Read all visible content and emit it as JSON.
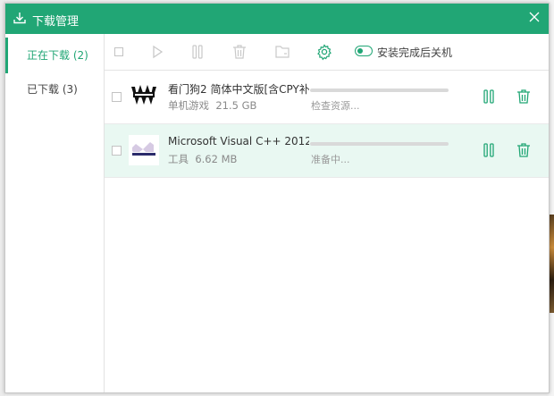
{
  "window": {
    "title": "下载管理"
  },
  "sidebar": {
    "items": [
      {
        "label": "正在下载 (2)",
        "active": true
      },
      {
        "label": "已下载 (3)",
        "active": false
      }
    ]
  },
  "toolbar": {
    "shutdown_label": "安装完成后关机",
    "icons": [
      "checkbox-icon",
      "play-icon",
      "pause-icon",
      "trash-icon",
      "folder-icon",
      "gear-icon",
      "toggle-icon"
    ]
  },
  "downloads": [
    {
      "name": "看门狗2  简体中文版[含CPY补…",
      "category": "单机游戏",
      "size": "21.5 GB",
      "status": "检查资源...",
      "progress": 0
    },
    {
      "name": "Microsoft Visual C++ 2012…",
      "category": "工具",
      "size": "6.62 MB",
      "status": "准备中...",
      "progress": 0
    }
  ],
  "colors": {
    "accent": "#21a675",
    "row_hover": "#e9f8f2",
    "icon_inactive": "#c9c9c9"
  }
}
